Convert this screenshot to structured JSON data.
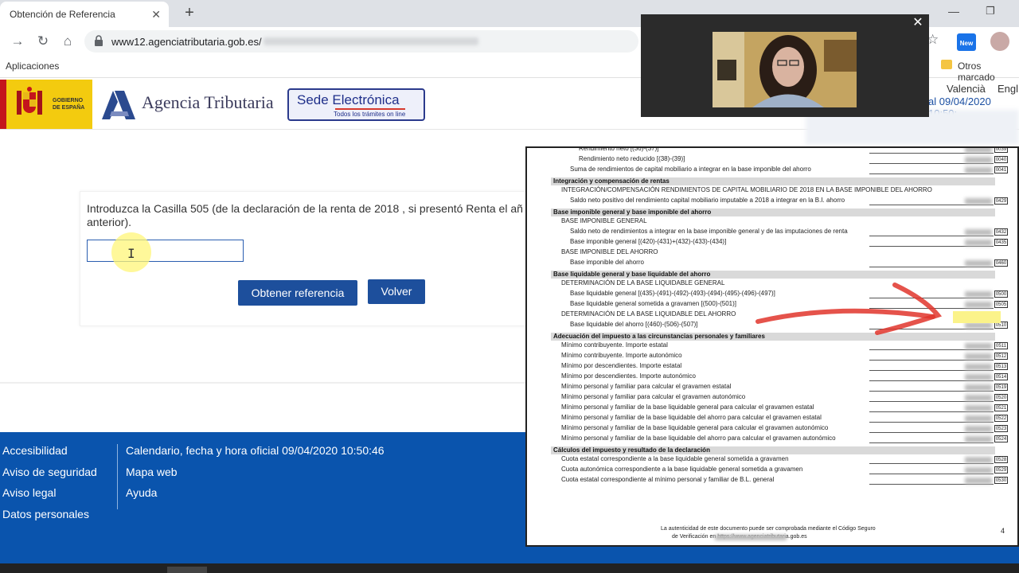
{
  "browser": {
    "tab_title": "Obtención de Referencia",
    "tab_close": "✕",
    "new_tab": "+",
    "url": "www12.agenciatributaria.gob.es/",
    "bookmarks_apps": "Aplicaciones",
    "bookmarks_others": "Otros marcado",
    "ext_badge": "New"
  },
  "header": {
    "gob_label": "GOBIERNO\nDE ESPAÑA",
    "agency_name": "Agencia Tributaria",
    "sede_title": "Sede Electrónica",
    "sede_subtitle": "Todos los trámites on line",
    "lang_ca": "o",
    "lang_va": "Valencià",
    "lang_en": "Engl",
    "clock": "al 09/04/2020 10:50:"
  },
  "form": {
    "instruction": "Introduzca la Casilla 505 (de la declaración de la renta de 2018 , si presentó Renta el añ anterior).",
    "input_value": "",
    "btn_obtener": "Obtener referencia",
    "btn_volver": "Volver"
  },
  "footer": {
    "col1": [
      "Accesibilidad",
      "Aviso de seguridad",
      "Aviso legal",
      "Datos personales"
    ],
    "col2": [
      "Calendario, fecha y hora oficial 09/04/2020 10:50:46",
      "Mapa web",
      "Ayuda"
    ]
  },
  "video": {
    "close": "✕"
  },
  "document": {
    "rows": [
      {
        "text": "Rendimiento neto [(36)-(37)]",
        "indent": 2,
        "box": "0039"
      },
      {
        "text": "Rendimiento neto reducido [(38)-(39)]",
        "indent": 2,
        "box": "0040"
      },
      {
        "text": "Suma de rendimientos de capital mobiliario a integrar en la base imponible del ahorro",
        "indent": 1,
        "box": "0041"
      },
      {
        "head": "Integración y compensación de rentas"
      },
      {
        "text": "INTEGRACIÓN/COMPENSACIÓN RENDIMIENTOS DE CAPITAL MOBILIARIO DE 2018 EN LA BASE IMPONIBLE DEL AHORRO",
        "indent": 0,
        "box": ""
      },
      {
        "text": "Saldo neto positivo del rendimiento capital mobiliario imputable a 2018 a integrar en la B.I. ahorro",
        "indent": 1,
        "box": "0429"
      },
      {
        "head": "Base imponible general y base imponible del ahorro"
      },
      {
        "text": "BASE IMPONIBLE GENERAL",
        "indent": 0,
        "box": ""
      },
      {
        "text": "Saldo neto de rendimientos a integrar en la base imponible general y de las imputaciones de renta",
        "indent": 1,
        "box": "0432"
      },
      {
        "text": "Base imponible general [(420)-(431)+(432)-(433)-(434)]",
        "indent": 1,
        "box": "0435"
      },
      {
        "text": "BASE IMPONIBLE DEL AHORRO",
        "indent": 0,
        "box": ""
      },
      {
        "text": "Base imponible del ahorro",
        "indent": 1,
        "box": "0460"
      },
      {
        "head": "Base liquidable general y base liquidable del ahorro"
      },
      {
        "text": "DETERMINACIÓN DE LA BASE LIQUIDABLE GENERAL",
        "indent": 0,
        "box": ""
      },
      {
        "text": "Base liquidable general [(435)-(491)-(492)-(493)-(494)-(495)-(496)-(497)]",
        "indent": 1,
        "box": "0500"
      },
      {
        "text": "Base liquidable general sometida a gravamen [(500)-(501)]",
        "indent": 1,
        "box": "0505"
      },
      {
        "text": "DETERMINACIÓN DE LA BASE LIQUIDABLE DEL AHORRO",
        "indent": 0,
        "box": ""
      },
      {
        "text": "Base liquidable del ahorro [(460)-(506)-(507)]",
        "indent": 1,
        "box": "0510"
      },
      {
        "head": "Adecuación del impuesto a las circunstancias personales y familiares"
      },
      {
        "text": "Mínimo contribuyente. Importe estatal",
        "indent": 0,
        "box": "0511"
      },
      {
        "text": "Mínimo contribuyente. Importe autonómico",
        "indent": 0,
        "box": "0512"
      },
      {
        "text": "Mínimo por descendientes. Importe estatal",
        "indent": 0,
        "box": "0513"
      },
      {
        "text": "Mínimo por descendientes. Importe autonómico",
        "indent": 0,
        "box": "0514"
      },
      {
        "text": "Mínimo personal y familiar para calcular el gravamen estatal",
        "indent": 0,
        "box": "0519"
      },
      {
        "text": "Mínimo personal y familiar para calcular el gravamen autonómico",
        "indent": 0,
        "box": "0520"
      },
      {
        "text": "Mínimo personal y familiar de la base liquidable general para calcular el gravamen estatal",
        "indent": 0,
        "box": "0521"
      },
      {
        "text": "Mínimo personal y familiar de la base liquidable del ahorro para calcular el gravamen estatal",
        "indent": 0,
        "box": "0522"
      },
      {
        "text": "Mínimo personal y familiar de la base liquidable general para calcular el gravamen autonómico",
        "indent": 0,
        "box": "0523"
      },
      {
        "text": "Mínimo personal y familiar de la base liquidable del ahorro para calcular el gravamen autonómico",
        "indent": 0,
        "box": "0524"
      },
      {
        "head": "Cálculos del impuesto y resultado de la declaración"
      },
      {
        "text": "Cuota estatal correspondiente a la base liquidable general sometida a gravamen",
        "indent": 0,
        "box": "0528"
      },
      {
        "text": "Cuota autonómica correspondiente a la base liquidable general sometida a gravamen",
        "indent": 0,
        "box": "0529"
      },
      {
        "text": "Cuota estatal correspondiente al mínimo personal y familiar de B.L. general",
        "indent": 0,
        "box": "0530"
      }
    ],
    "footer_line1": "La autenticidad de este documento puede ser comprobada mediante el Código Seguro",
    "footer_line2": "de Verificación                                  en https://www.agenciatributaria.gob.es",
    "page_number": "4",
    "highlight_color": "#fbf38a",
    "arrow_color": "#e0352b"
  }
}
